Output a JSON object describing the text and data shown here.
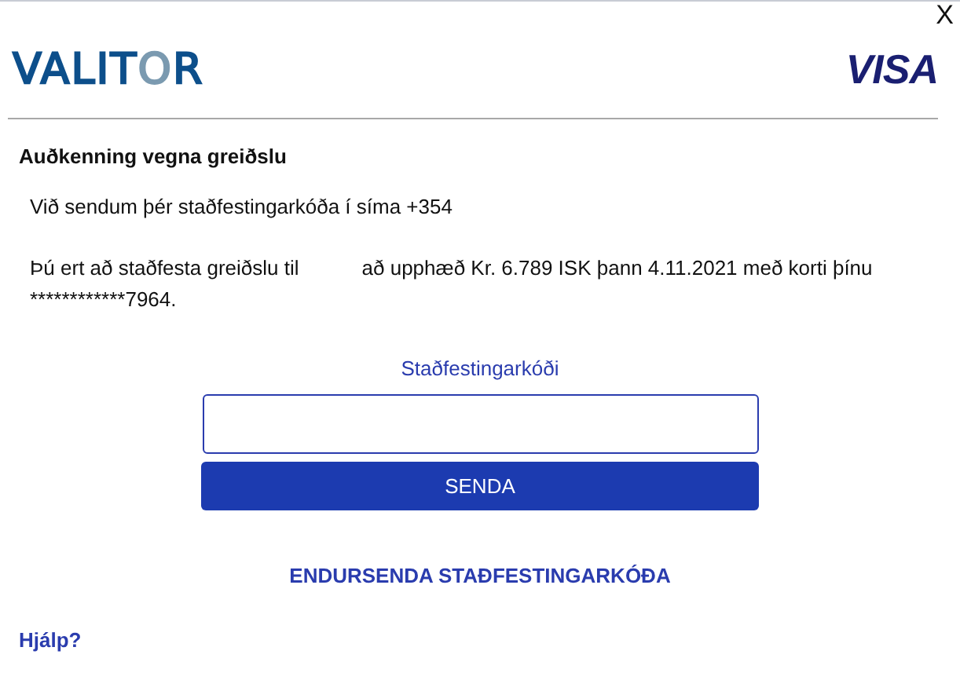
{
  "close": "X",
  "logos": {
    "valitor": [
      "VALIT",
      "O",
      "R"
    ],
    "visa": "VISA"
  },
  "heading": "Auðkenning vegna greiðslu",
  "sent_text": "Við sendum þér staðfestingarkóða í síma +354",
  "payment_text": [
    "Þú ert að staðfesta greiðslu til",
    "að upphæð Kr. 6.789 ISK þann 4.11.2021 með korti þínu ************7964."
  ],
  "code_field": {
    "label": "Staðfestingarkóði"
  },
  "submit_button": "SENDA",
  "resend_link": "ENDURSENDA STAÐFESTINGARKÓÐA",
  "help_link": "Hjálp?"
}
